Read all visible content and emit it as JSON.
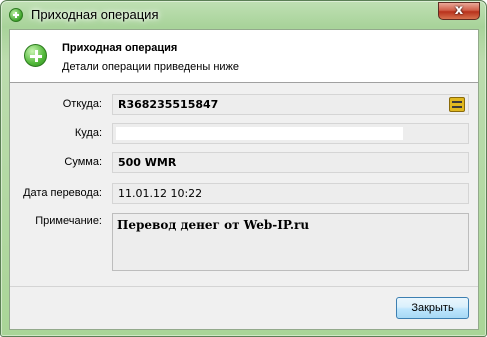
{
  "window": {
    "title": "Приходная операция",
    "close_symbol": "x"
  },
  "header": {
    "title": "Приходная операция",
    "subtitle": "Детали операции приведены ниже"
  },
  "fields": {
    "from": {
      "label": "Откуда:",
      "value": "R368235515847"
    },
    "to": {
      "label": "Куда:",
      "value": ""
    },
    "amount": {
      "label": "Сумма:",
      "value": "500 WMR"
    },
    "date": {
      "label": "Дата перевода:",
      "value": "11.01.12 10:22"
    },
    "note": {
      "label": "Примечание:",
      "value": "Перевод денег от Web-IP.ru"
    }
  },
  "buttons": {
    "close_label": "Закрыть"
  },
  "colors": {
    "accent": "#52b83a",
    "button_border": "#3c7fb1"
  },
  "icons": [
    "plus-circle-icon",
    "wallet-icon"
  ]
}
